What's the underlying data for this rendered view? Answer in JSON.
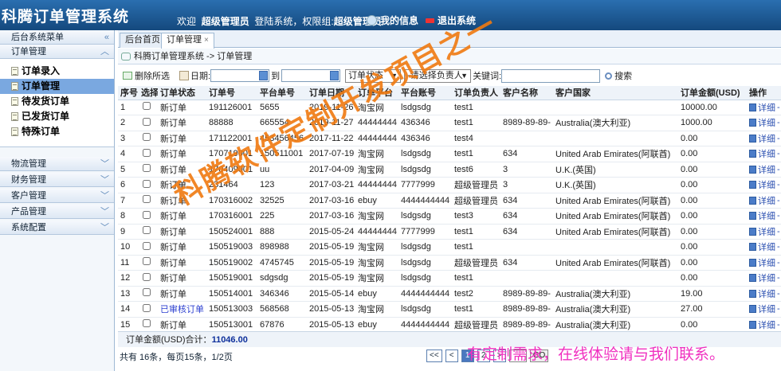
{
  "header": {
    "app_title": "科腾订单管理系统",
    "welcome_prefix": "欢迎",
    "username": "超级管理员",
    "login_text": "登陆系统，权限组:",
    "role": "超级管理员",
    "my_info_label": "我的信息",
    "logout_label": "退出系统"
  },
  "sidebar": {
    "menu_title": "后台系统菜单",
    "collapse_glyph": "«",
    "groups": [
      {
        "label": "订单管理",
        "toggle": "︿"
      },
      {
        "label": "物流管理",
        "toggle": "﹀"
      },
      {
        "label": "财务管理",
        "toggle": "﹀"
      },
      {
        "label": "客户管理",
        "toggle": "﹀"
      },
      {
        "label": "产品管理",
        "toggle": "﹀"
      },
      {
        "label": "系统配置",
        "toggle": "﹀"
      }
    ],
    "order_items": [
      {
        "label": "订单录入"
      },
      {
        "label": "订单管理"
      },
      {
        "label": "待发货订单"
      },
      {
        "label": "已发货订单"
      },
      {
        "label": "特殊订单"
      }
    ]
  },
  "tabs": [
    {
      "label": "后台首页"
    },
    {
      "label": "订单管理",
      "close": "×"
    }
  ],
  "breadcrumb": "科腾订单管理系统 -> 订单管理",
  "toolbar": {
    "delete_label": "删除所选",
    "date_label": "日期:",
    "to_label": "到",
    "status_select": "订单状态",
    "owner_select": "-请选择负责人-",
    "keyword_label": "关键词:",
    "search_label": "搜索"
  },
  "table": {
    "columns": [
      "序号",
      "选择",
      "订单状态",
      "订单号",
      "平台单号",
      "订单日期",
      "订单平台",
      "平台账号",
      "订单负责人",
      "客户名称",
      "客户国家",
      "订单金额(USD)",
      "操作"
    ],
    "detail_label": "详细",
    "rows": [
      {
        "no": "1",
        "status": "新订单",
        "order_no": "191126001",
        "platform_no": "5655",
        "date": "2019-11-26",
        "platform": "淘宝网",
        "account": "lsdgsdg",
        "owner": "test1",
        "customer": "",
        "country": "",
        "amount": "10000.00"
      },
      {
        "no": "2",
        "status": "新订单",
        "order_no": "88888",
        "platform_no": "665554",
        "date": "2019-11-27",
        "platform": "44444444",
        "account": "436346",
        "owner": "test1",
        "customer": "8989-89-89-",
        "country": "Australia(澳大利亚)",
        "amount": "1000.00"
      },
      {
        "no": "3",
        "status": "新订单",
        "order_no": "171122001",
        "platform_no": "453456456",
        "date": "2017-11-22",
        "platform": "44444444",
        "account": "436346",
        "owner": "test4",
        "customer": "",
        "country": "",
        "amount": "0.00"
      },
      {
        "no": "4",
        "status": "新订单",
        "order_no": "170719001",
        "platform_no": "150511001",
        "date": "2017-07-19",
        "platform": "淘宝网",
        "account": "lsdgsdg",
        "owner": "test1",
        "customer": "634",
        "country": "United Arab Emirates(阿联酋)",
        "amount": "0.00"
      },
      {
        "no": "5",
        "status": "新订单",
        "order_no": "170409001",
        "platform_no": "uu",
        "date": "2017-04-09",
        "platform": "淘宝网",
        "account": "lsdgsdg",
        "owner": "test6",
        "customer": "3",
        "country": "U.K.(英国)",
        "amount": "0.00"
      },
      {
        "no": "6",
        "status": "新订单",
        "order_no": "231464",
        "platform_no": "123",
        "date": "2017-03-21",
        "platform": "44444444",
        "account": "7777999",
        "owner": "超级管理员",
        "customer": "3",
        "country": "U.K.(英国)",
        "amount": "0.00"
      },
      {
        "no": "7",
        "status": "新订单",
        "order_no": "170316002",
        "platform_no": "32525",
        "date": "2017-03-16",
        "platform": "ebuy",
        "account": "4444444444",
        "owner": "超级管理员",
        "customer": "634",
        "country": "United Arab Emirates(阿联酋)",
        "amount": "0.00"
      },
      {
        "no": "8",
        "status": "新订单",
        "order_no": "170316001",
        "platform_no": "225",
        "date": "2017-03-16",
        "platform": "淘宝网",
        "account": "lsdgsdg",
        "owner": "test3",
        "customer": "634",
        "country": "United Arab Emirates(阿联酋)",
        "amount": "0.00"
      },
      {
        "no": "9",
        "status": "新订单",
        "order_no": "150524001",
        "platform_no": "888",
        "date": "2015-05-24",
        "platform": "44444444",
        "account": "7777999",
        "owner": "test1",
        "customer": "634",
        "country": "United Arab Emirates(阿联酋)",
        "amount": "0.00"
      },
      {
        "no": "10",
        "status": "新订单",
        "order_no": "150519003",
        "platform_no": "898988",
        "date": "2015-05-19",
        "platform": "淘宝网",
        "account": "lsdgsdg",
        "owner": "test1",
        "customer": "",
        "country": "",
        "amount": "0.00"
      },
      {
        "no": "11",
        "status": "新订单",
        "order_no": "150519002",
        "platform_no": "4745745",
        "date": "2015-05-19",
        "platform": "淘宝网",
        "account": "lsdgsdg",
        "owner": "超级管理员",
        "customer": "634",
        "country": "United Arab Emirates(阿联酋)",
        "amount": "0.00"
      },
      {
        "no": "12",
        "status": "新订单",
        "order_no": "150519001",
        "platform_no": "sdgsdg",
        "date": "2015-05-19",
        "platform": "淘宝网",
        "account": "lsdgsdg",
        "owner": "test1",
        "customer": "",
        "country": "",
        "amount": "0.00"
      },
      {
        "no": "13",
        "status": "新订单",
        "order_no": "150514001",
        "platform_no": "346346",
        "date": "2015-05-14",
        "platform": "ebuy",
        "account": "4444444444",
        "owner": "test2",
        "customer": "8989-89-89-",
        "country": "Australia(澳大利亚)",
        "amount": "19.00"
      },
      {
        "no": "14",
        "status": "已审核订单",
        "order_no": "150513003",
        "platform_no": "568568",
        "date": "2015-05-13",
        "platform": "淘宝网",
        "account": "lsdgsdg",
        "owner": "test1",
        "customer": "8989-89-89-",
        "country": "Australia(澳大利亚)",
        "amount": "27.00"
      },
      {
        "no": "15",
        "status": "新订单",
        "order_no": "150513001",
        "platform_no": "67876",
        "date": "2015-05-13",
        "platform": "ebuy",
        "account": "4444444444",
        "owner": "超级管理员",
        "customer": "8989-89-89-",
        "country": "Australia(澳大利亚)",
        "amount": "0.00"
      }
    ]
  },
  "total": {
    "label": "订单金额(USD)合计：",
    "value": "11046.00"
  },
  "pager": {
    "info": "共有 16条，每页15条，1/2页",
    "first": "<<",
    "prev": "<",
    "pages": [
      "1",
      "2"
    ],
    "next": ">",
    "go_label": "GO"
  },
  "watermark": "科腾软件定制开发项目之一",
  "promo": "有定制需求，在线体验请与我们联系。",
  "colors": {
    "header_bg": "#1f5e9a",
    "active_menu": "#7aa8e0",
    "watermark": "#f07a10",
    "promo": "#f030c0",
    "total_value": "#0d2f9b"
  }
}
